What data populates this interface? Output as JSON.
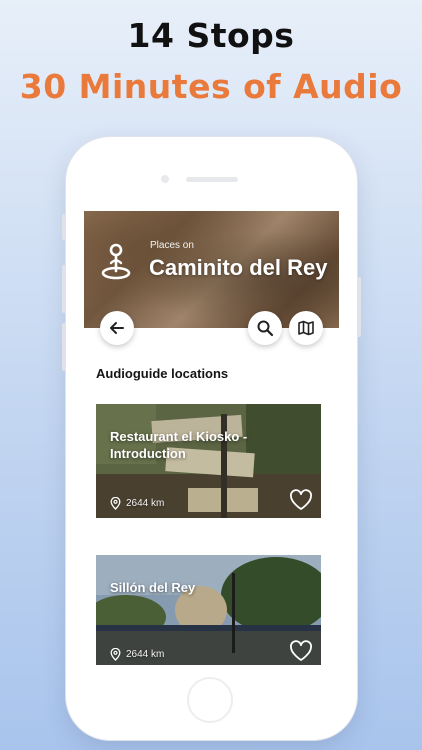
{
  "promo": {
    "line1": "14 Stops",
    "line2": "30 Minutes of Audio"
  },
  "header": {
    "subtitle": "Places on",
    "title": "Caminito del Rey"
  },
  "section": {
    "title": "Audioguide locations"
  },
  "locations": [
    {
      "title": "Restaurant el Kiosko - Introduction",
      "distance": "2644 km"
    },
    {
      "title": "Sillón del Rey",
      "distance": "2644 km"
    }
  ],
  "colors": {
    "accent": "#ea7a3b",
    "headline": "#111111"
  },
  "icons": {
    "back": "arrow-left-icon",
    "search": "search-icon",
    "map": "map-icon",
    "pin": "location-pin-icon",
    "favorite": "heart-icon"
  }
}
